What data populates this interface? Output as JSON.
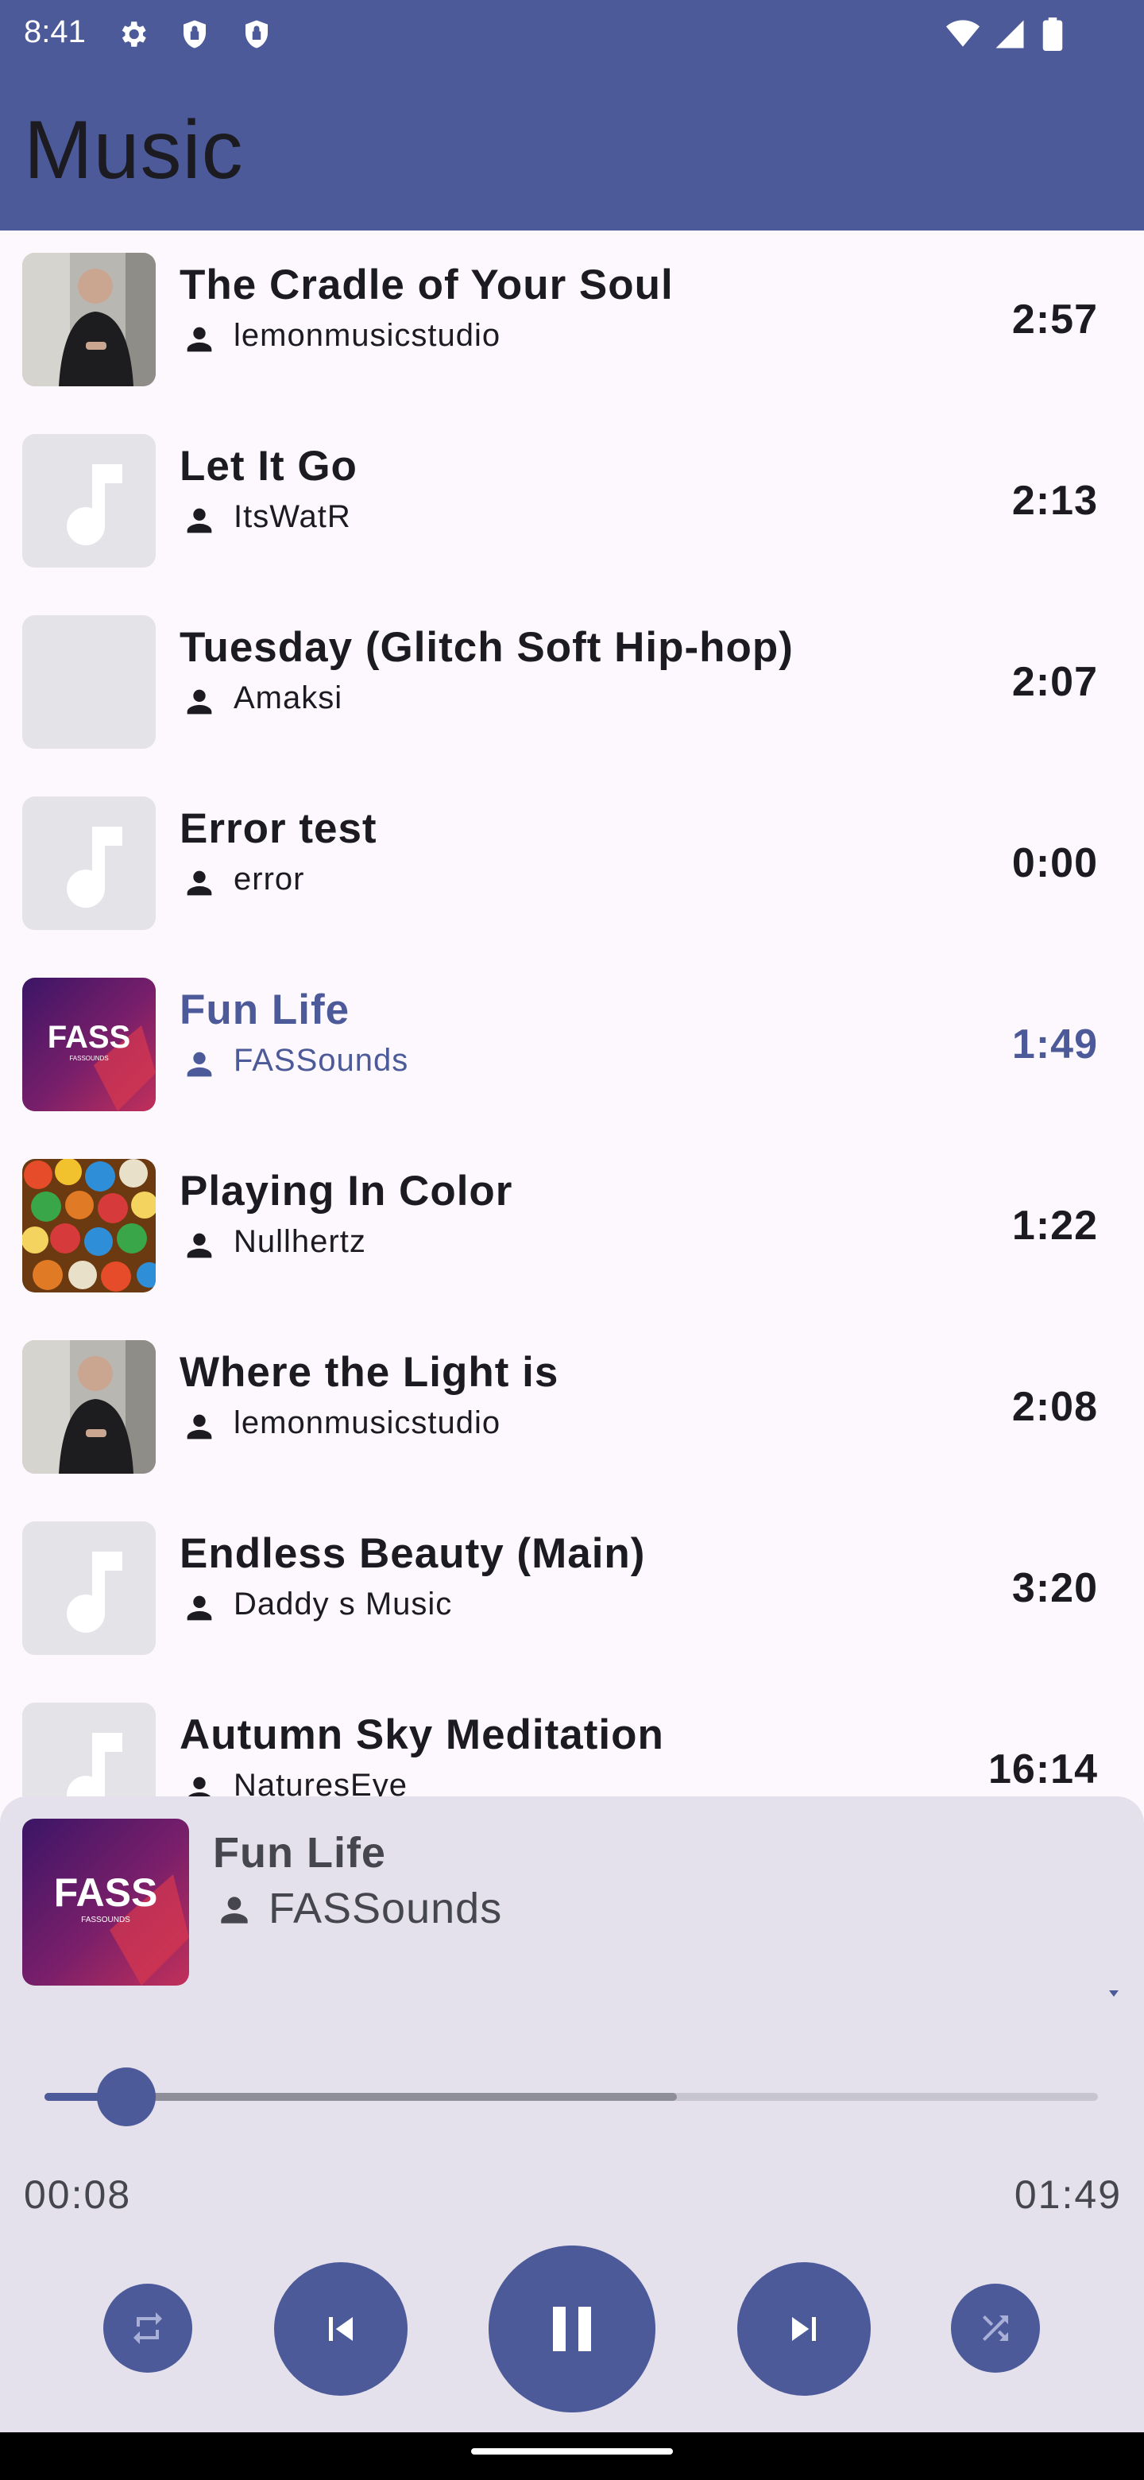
{
  "status_bar": {
    "time": "8:41",
    "left_icons": [
      "gear-icon",
      "shield-icon",
      "shield-icon"
    ],
    "right_icons": [
      "wifi-icon",
      "signal-icon",
      "battery-icon"
    ]
  },
  "app_bar": {
    "title": "Music",
    "color": "#4c5a99"
  },
  "songs": [
    {
      "title": "The Cradle of Your Soul",
      "artist": "lemonmusicstudio",
      "duration": "2:57",
      "art": "person-photo",
      "active": false
    },
    {
      "title": "Let It Go",
      "artist": "ItsWatR",
      "duration": "2:13",
      "art": "music-note-placeholder",
      "active": false
    },
    {
      "title": "Tuesday (Glitch Soft Hip-hop)",
      "artist": "Amaksi",
      "duration": "2:07",
      "art": "blank-placeholder",
      "active": false
    },
    {
      "title": "Error test",
      "artist": "error",
      "duration": "0:00",
      "art": "music-note-placeholder",
      "active": false
    },
    {
      "title": "Fun Life",
      "artist": "FASSounds",
      "duration": "1:49",
      "art": "fass-logo",
      "active": true
    },
    {
      "title": "Playing In Color",
      "artist": "Nullhertz",
      "duration": "1:22",
      "art": "marbles-photo",
      "active": false
    },
    {
      "title": "Where the Light is",
      "artist": "lemonmusicstudio",
      "duration": "2:08",
      "art": "person-photo",
      "active": false
    },
    {
      "title": "Endless Beauty (Main)",
      "artist": "Daddy s Music",
      "duration": "3:20",
      "art": "music-note-placeholder",
      "active": false
    },
    {
      "title": "Autumn Sky Meditation",
      "artist": "NaturesEye",
      "duration": "16:14",
      "art": "music-note-placeholder",
      "active": false
    }
  ],
  "player": {
    "title": "Fun Life",
    "artist": "FASSounds",
    "art_logo_text": "FASS",
    "art_logo_sub": "FASSOUNDS",
    "current_time": "00:08",
    "total_time": "01:49",
    "progress_fraction": 0.078,
    "buffered_fraction": 0.6,
    "buttons": [
      "repeat-icon",
      "skip-previous-icon",
      "pause-icon",
      "skip-next-icon",
      "shuffle-icon"
    ]
  }
}
